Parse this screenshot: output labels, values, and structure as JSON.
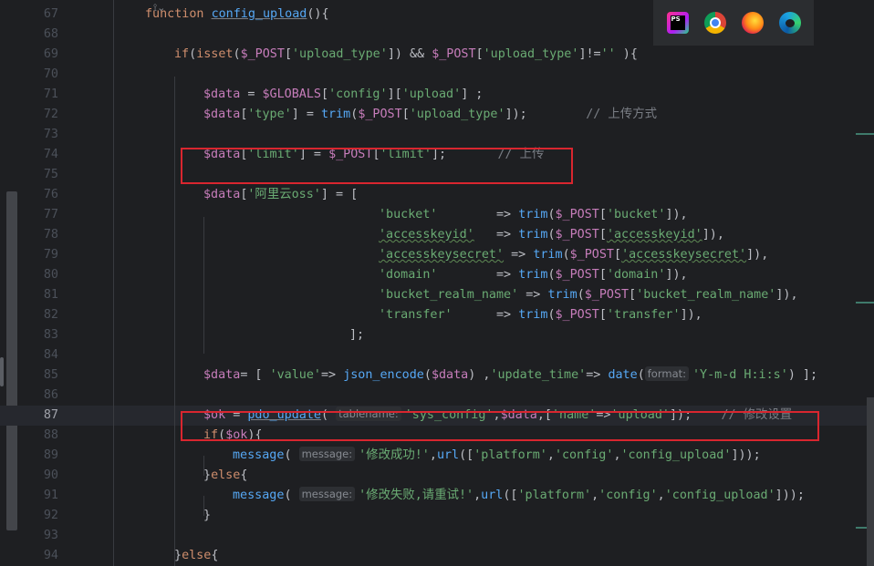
{
  "editor": {
    "lines": [
      {
        "num": "67",
        "indent": 0,
        "tokens": [
          [
            "kw",
            "function "
          ],
          [
            "fn uline",
            "config_upload"
          ],
          [
            "tx",
            "(){"
          ]
        ]
      },
      {
        "num": "68",
        "indent": 0,
        "tokens": []
      },
      {
        "num": "69",
        "indent": 4,
        "tokens": [
          [
            "kw",
            "if"
          ],
          [
            "tx",
            "("
          ],
          [
            "kw",
            "isset"
          ],
          [
            "tx",
            "("
          ],
          [
            "vr",
            "$_POST"
          ],
          [
            "tx",
            "["
          ],
          [
            "st",
            "'upload_type'"
          ],
          [
            "tx",
            "]) && "
          ],
          [
            "vr",
            "$_POST"
          ],
          [
            "tx",
            "["
          ],
          [
            "st",
            "'upload_type'"
          ],
          [
            "tx",
            "]!="
          ],
          [
            "st",
            "''"
          ],
          [
            "tx",
            " ){"
          ]
        ]
      },
      {
        "num": "70",
        "indent": 0,
        "tokens": []
      },
      {
        "num": "71",
        "indent": 8,
        "tokens": [
          [
            "vr",
            "$data"
          ],
          [
            "tx",
            " = "
          ],
          [
            "vr",
            "$GLOBALS"
          ],
          [
            "tx",
            "["
          ],
          [
            "st",
            "'config'"
          ],
          [
            "tx",
            "]["
          ],
          [
            "st",
            "'upload'"
          ],
          [
            "tx",
            "] ;"
          ]
        ]
      },
      {
        "num": "72",
        "indent": 8,
        "tokens": [
          [
            "vr",
            "$data"
          ],
          [
            "tx",
            "["
          ],
          [
            "st",
            "'type'"
          ],
          [
            "tx",
            "] = "
          ],
          [
            "fn",
            "trim"
          ],
          [
            "tx",
            "("
          ],
          [
            "vr",
            "$_POST"
          ],
          [
            "tx",
            "["
          ],
          [
            "st",
            "'upload_type'"
          ],
          [
            "tx",
            "]);        "
          ],
          [
            "cm",
            "// 上传方式"
          ]
        ]
      },
      {
        "num": "73",
        "indent": 0,
        "tokens": []
      },
      {
        "num": "74",
        "indent": 8,
        "tokens": [
          [
            "vr",
            "$data"
          ],
          [
            "tx",
            "["
          ],
          [
            "st",
            "'limit'"
          ],
          [
            "tx",
            "] = "
          ],
          [
            "vr",
            "$_POST"
          ],
          [
            "tx",
            "["
          ],
          [
            "st",
            "'limit'"
          ],
          [
            "tx",
            "];       "
          ],
          [
            "cm",
            "// 上传"
          ]
        ]
      },
      {
        "num": "75",
        "indent": 0,
        "tokens": []
      },
      {
        "num": "76",
        "indent": 8,
        "tokens": [
          [
            "vr",
            "$data"
          ],
          [
            "tx",
            "["
          ],
          [
            "st",
            "'阿里云oss'"
          ],
          [
            "tx",
            "] = ["
          ]
        ]
      },
      {
        "num": "77",
        "indent": 32,
        "tokens": [
          [
            "st",
            "'bucket'"
          ],
          [
            "tx",
            "        => "
          ],
          [
            "fn",
            "trim"
          ],
          [
            "tx",
            "("
          ],
          [
            "vr",
            "$_POST"
          ],
          [
            "tx",
            "["
          ],
          [
            "st",
            "'bucket'"
          ],
          [
            "tx",
            "]),"
          ]
        ]
      },
      {
        "num": "78",
        "indent": 32,
        "tokens": [
          [
            "st squig",
            "'accesskeyid'"
          ],
          [
            "tx",
            "   => "
          ],
          [
            "fn",
            "trim"
          ],
          [
            "tx",
            "("
          ],
          [
            "vr",
            "$_POST"
          ],
          [
            "tx",
            "["
          ],
          [
            "st squig",
            "'accesskeyid'"
          ],
          [
            "tx",
            "]),"
          ]
        ]
      },
      {
        "num": "79",
        "indent": 32,
        "tokens": [
          [
            "st squig",
            "'accesskeysecret'"
          ],
          [
            "tx",
            " => "
          ],
          [
            "fn",
            "trim"
          ],
          [
            "tx",
            "("
          ],
          [
            "vr",
            "$_POST"
          ],
          [
            "tx",
            "["
          ],
          [
            "st squig",
            "'accesskeysecret'"
          ],
          [
            "tx",
            "]),"
          ]
        ]
      },
      {
        "num": "80",
        "indent": 32,
        "tokens": [
          [
            "st",
            "'domain'"
          ],
          [
            "tx",
            "        => "
          ],
          [
            "fn",
            "trim"
          ],
          [
            "tx",
            "("
          ],
          [
            "vr",
            "$_POST"
          ],
          [
            "tx",
            "["
          ],
          [
            "st",
            "'domain'"
          ],
          [
            "tx",
            "]),"
          ]
        ]
      },
      {
        "num": "81",
        "indent": 32,
        "tokens": [
          [
            "st",
            "'bucket_realm_name'"
          ],
          [
            "tx",
            " => "
          ],
          [
            "fn",
            "trim"
          ],
          [
            "tx",
            "("
          ],
          [
            "vr",
            "$_POST"
          ],
          [
            "tx",
            "["
          ],
          [
            "st",
            "'bucket_realm_name'"
          ],
          [
            "tx",
            "]),"
          ]
        ]
      },
      {
        "num": "82",
        "indent": 32,
        "tokens": [
          [
            "st",
            "'transfer'"
          ],
          [
            "tx",
            "      => "
          ],
          [
            "fn",
            "trim"
          ],
          [
            "tx",
            "("
          ],
          [
            "vr",
            "$_POST"
          ],
          [
            "tx",
            "["
          ],
          [
            "st",
            "'transfer'"
          ],
          [
            "tx",
            "]),"
          ]
        ]
      },
      {
        "num": "83",
        "indent": 28,
        "tokens": [
          [
            "tx",
            "];"
          ]
        ]
      },
      {
        "num": "84",
        "indent": 0,
        "tokens": []
      },
      {
        "num": "85",
        "indent": 8,
        "tokens": [
          [
            "vr",
            "$data"
          ],
          [
            "tx",
            "= [ "
          ],
          [
            "st",
            "'value'"
          ],
          [
            "tx",
            "=> "
          ],
          [
            "fn",
            "json_encode"
          ],
          [
            "tx",
            "("
          ],
          [
            "vr",
            "$data"
          ],
          [
            "tx",
            ") ,"
          ],
          [
            "st",
            "'update_time'"
          ],
          [
            "tx",
            "=> "
          ],
          [
            "fn",
            "date"
          ],
          [
            "tx",
            "("
          ],
          [
            "hint",
            "format:"
          ],
          [
            "st",
            "'Y-m-d H:i:s'"
          ],
          [
            "tx",
            ") ];"
          ]
        ]
      },
      {
        "num": "86",
        "indent": 0,
        "tokens": []
      },
      {
        "num": "87",
        "indent": 8,
        "current": true,
        "tokens": [
          [
            "vr",
            "$ok"
          ],
          [
            "tx",
            " = "
          ],
          [
            "fn uline",
            "pdo_update"
          ],
          [
            "tx",
            "( "
          ],
          [
            "hint",
            "tablename:"
          ],
          [
            "st",
            "'sys_config'"
          ],
          [
            "tx",
            ","
          ],
          [
            "vr",
            "$data"
          ],
          [
            "tx",
            ",["
          ],
          [
            "st",
            "'name'"
          ],
          [
            "tx",
            "=>"
          ],
          [
            "st",
            "'upload'"
          ],
          [
            "tx",
            "]);    "
          ],
          [
            "cm",
            "// 修改设置"
          ]
        ]
      },
      {
        "num": "88",
        "indent": 8,
        "tokens": [
          [
            "kw",
            "if"
          ],
          [
            "tx",
            "("
          ],
          [
            "vr",
            "$ok"
          ],
          [
            "tx",
            "){"
          ]
        ]
      },
      {
        "num": "89",
        "indent": 12,
        "tokens": [
          [
            "fn",
            "message"
          ],
          [
            "tx",
            "( "
          ],
          [
            "hint",
            "message:"
          ],
          [
            "st",
            "'修改成功!'"
          ],
          [
            "tx",
            ","
          ],
          [
            "fn",
            "url"
          ],
          [
            "tx",
            "(["
          ],
          [
            "st",
            "'platform'"
          ],
          [
            "tx",
            ","
          ],
          [
            "st",
            "'config'"
          ],
          [
            "tx",
            ","
          ],
          [
            "st",
            "'config_upload'"
          ],
          [
            "tx",
            "]));"
          ]
        ]
      },
      {
        "num": "90",
        "indent": 8,
        "tokens": [
          [
            "tx",
            "}"
          ],
          [
            "kw",
            "else"
          ],
          [
            "tx",
            "{"
          ]
        ]
      },
      {
        "num": "91",
        "indent": 12,
        "tokens": [
          [
            "fn",
            "message"
          ],
          [
            "tx",
            "( "
          ],
          [
            "hint",
            "message:"
          ],
          [
            "st",
            "'修改失败,请重试!'"
          ],
          [
            "tx",
            ","
          ],
          [
            "fn",
            "url"
          ],
          [
            "tx",
            "(["
          ],
          [
            "st",
            "'platform'"
          ],
          [
            "tx",
            ","
          ],
          [
            "st",
            "'config'"
          ],
          [
            "tx",
            ","
          ],
          [
            "st",
            "'config_upload'"
          ],
          [
            "tx",
            "]));"
          ]
        ]
      },
      {
        "num": "92",
        "indent": 8,
        "tokens": [
          [
            "tx",
            "}"
          ]
        ]
      },
      {
        "num": "93",
        "indent": 0,
        "tokens": []
      },
      {
        "num": "94",
        "indent": 4,
        "tokens": [
          [
            "tx",
            "}"
          ],
          [
            "kw",
            "else"
          ],
          [
            "tx",
            "{"
          ]
        ]
      }
    ]
  },
  "toolbar": {
    "browsers": [
      {
        "name": "phpstorm-icon",
        "label": "PS"
      },
      {
        "name": "chrome-icon"
      },
      {
        "name": "firefox-icon"
      },
      {
        "name": "edge-icon"
      }
    ]
  },
  "colors": {
    "background": "#1e1f22",
    "keyword": "#cf8e6d",
    "function": "#56a8f5",
    "variable": "#c77dbb",
    "string": "#6aab73",
    "comment": "#7a7e85",
    "highlight_box": "#d9262f"
  }
}
